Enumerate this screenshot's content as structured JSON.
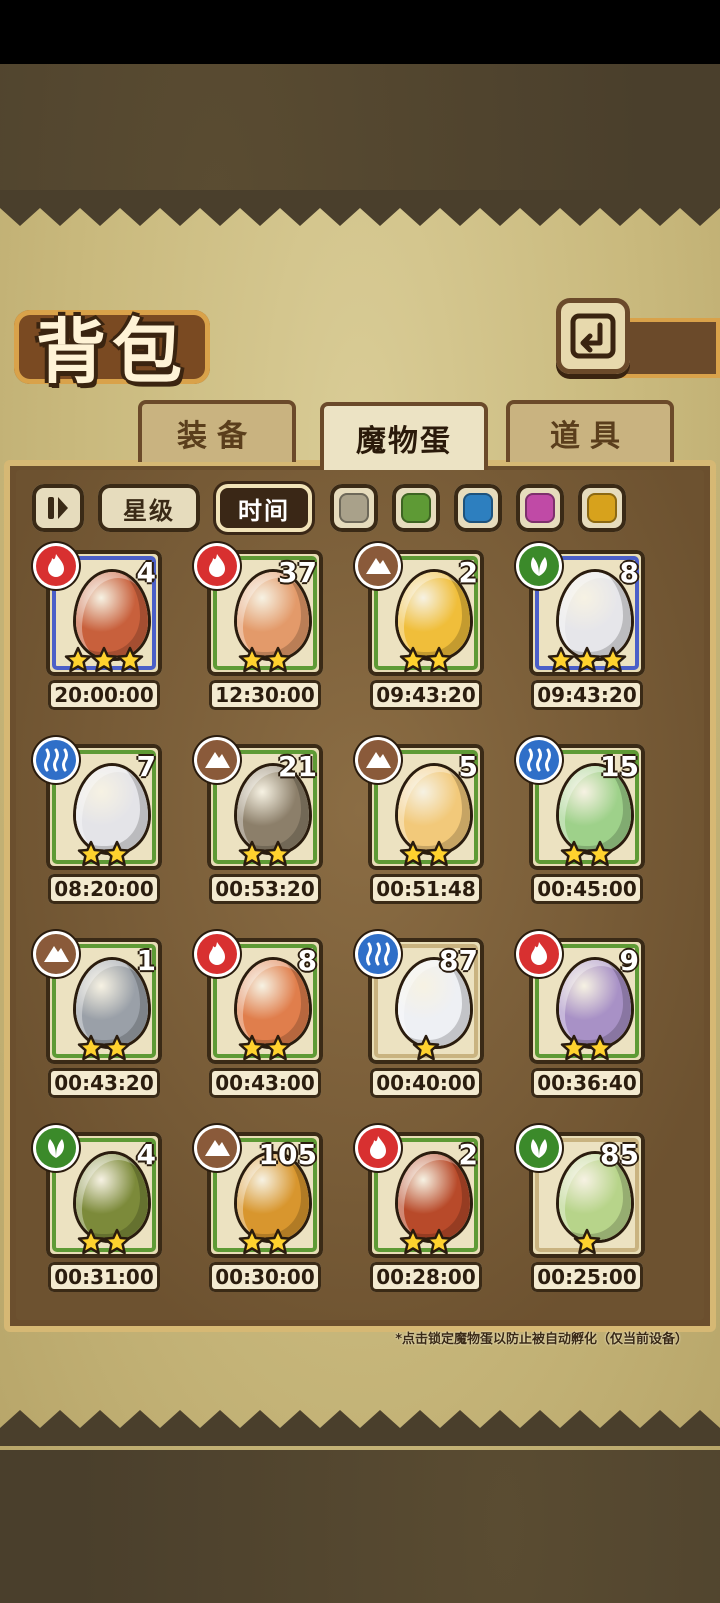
{
  "screen": {
    "title": "背包",
    "tabs": [
      {
        "label": "装备",
        "active": false
      },
      {
        "label": "魔物蛋",
        "active": true
      },
      {
        "label": "道具",
        "active": false
      }
    ],
    "filters": {
      "sort_icon": "pause-icon",
      "star_label": "星级",
      "time_label": "时间",
      "time_selected": true,
      "color_swatches": [
        "#a9a18a",
        "#5e9a35",
        "#2d7fbf",
        "#c04aa6",
        "#d7a21c"
      ]
    },
    "eggs": [
      {
        "count": "4",
        "timer": "20:00:00",
        "element": "fire",
        "stars": 3,
        "frame": "blue",
        "color": "#c8603c"
      },
      {
        "count": "37",
        "timer": "12:30:00",
        "element": "fire",
        "stars": 2,
        "frame": "green",
        "color": "#e39a6a"
      },
      {
        "count": "2",
        "timer": "09:43:20",
        "element": "earth",
        "stars": 2,
        "frame": "green",
        "color": "#f0be3a"
      },
      {
        "count": "8",
        "timer": "09:43:20",
        "element": "nature",
        "stars": 3,
        "frame": "blue",
        "color": "#e6e6ea"
      },
      {
        "count": "7",
        "timer": "08:20:00",
        "element": "water",
        "stars": 2,
        "frame": "green",
        "color": "#e4e4e8"
      },
      {
        "count": "21",
        "timer": "00:53:20",
        "element": "earth",
        "stars": 2,
        "frame": "green",
        "color": "#8c7f6a"
      },
      {
        "count": "5",
        "timer": "00:51:48",
        "element": "earth",
        "stars": 2,
        "frame": "green",
        "color": "#f2c97a"
      },
      {
        "count": "15",
        "timer": "00:45:00",
        "element": "water",
        "stars": 2,
        "frame": "green",
        "color": "#9ed18a"
      },
      {
        "count": "1",
        "timer": "00:43:20",
        "element": "earth",
        "stars": 2,
        "frame": "green",
        "color": "#9aa0a8"
      },
      {
        "count": "8",
        "timer": "00:43:00",
        "element": "fire",
        "stars": 2,
        "frame": "green",
        "color": "#e07e4c"
      },
      {
        "count": "87",
        "timer": "00:40:00",
        "element": "water",
        "stars": 1,
        "frame": "tan",
        "color": "#eef0f4"
      },
      {
        "count": "9",
        "timer": "00:36:40",
        "element": "fire",
        "stars": 2,
        "frame": "green",
        "color": "#a891c6"
      },
      {
        "count": "4",
        "timer": "00:31:00",
        "element": "nature",
        "stars": 2,
        "frame": "green",
        "color": "#7c8a3a"
      },
      {
        "count": "105",
        "timer": "00:30:00",
        "element": "earth",
        "stars": 2,
        "frame": "green",
        "color": "#d8962e"
      },
      {
        "count": "2",
        "timer": "00:28:00",
        "element": "fire",
        "stars": 2,
        "frame": "green",
        "color": "#b84a2a"
      },
      {
        "count": "85",
        "timer": "00:25:00",
        "element": "nature",
        "stars": 1,
        "frame": "tan",
        "color": "#b7d48a"
      }
    ],
    "element_colors": {
      "fire": "#d83030",
      "earth": "#8a5a3a",
      "nature": "#3b8a2a",
      "water": "#2f6fc8"
    },
    "footnote": "*点击锁定魔物蛋以防止被自动孵化（仅当前设备）"
  }
}
